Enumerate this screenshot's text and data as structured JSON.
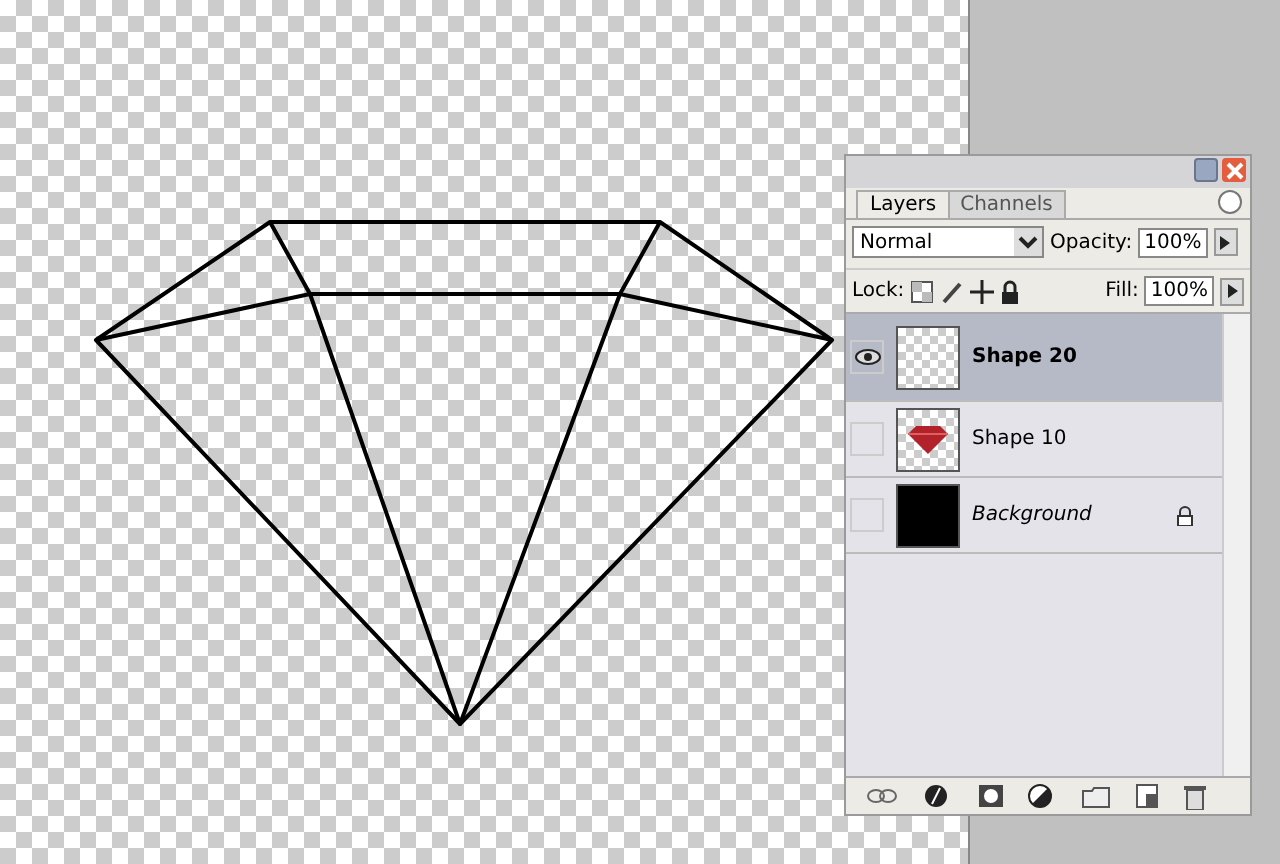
{
  "tabs": [
    {
      "label": "Layers",
      "selected": true
    },
    {
      "label": "Channels",
      "selected": false
    }
  ],
  "blend_mode": {
    "value": "Normal"
  },
  "opacity": {
    "label": "Opacity:",
    "value": "100%"
  },
  "lock": {
    "label": "Lock:"
  },
  "fill": {
    "label": "Fill:",
    "value": "100%"
  },
  "layers": [
    {
      "name": "Shape 20",
      "visible": true,
      "selected": true,
      "kind": "transparent",
      "locked": false
    },
    {
      "name": "Shape 10",
      "visible": false,
      "selected": false,
      "kind": "gem",
      "locked": false
    },
    {
      "name": "Background",
      "visible": false,
      "selected": false,
      "kind": "background",
      "locked": true
    }
  ]
}
